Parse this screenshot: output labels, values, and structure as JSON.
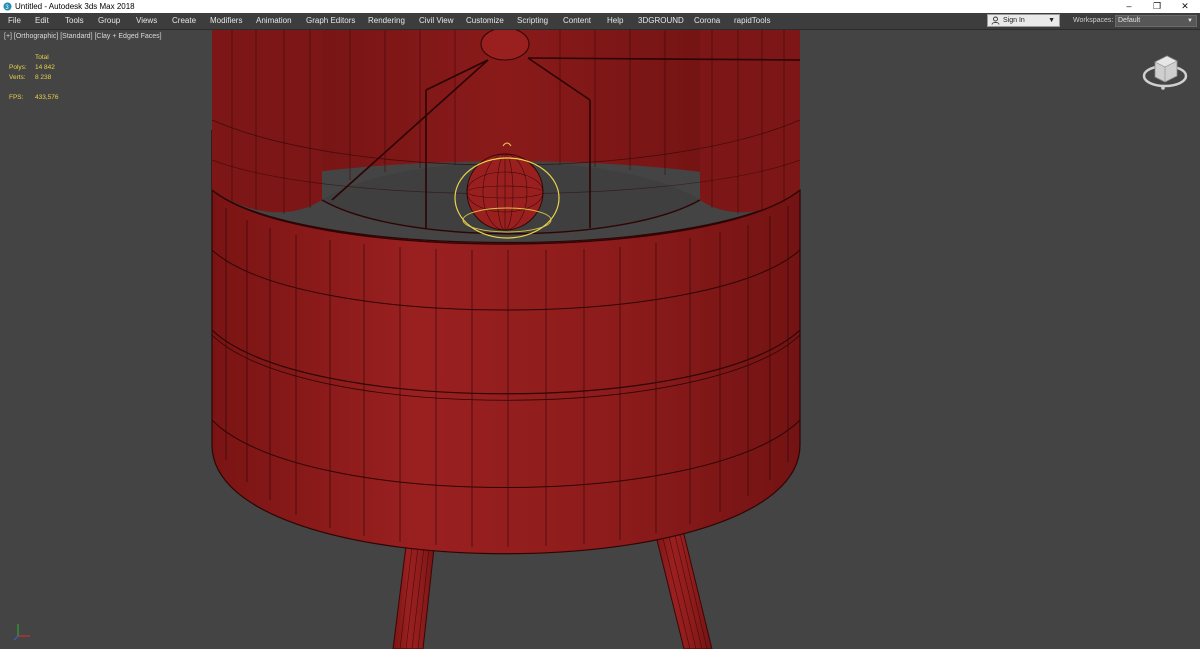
{
  "window": {
    "title": "Untitled - Autodesk 3ds Max 2018",
    "controls": {
      "minimize": "–",
      "restore": "❐",
      "close": "✕"
    }
  },
  "menu": {
    "items": [
      "File",
      "Edit",
      "Tools",
      "Group",
      "Views",
      "Create",
      "Modifiers",
      "Animation",
      "Graph Editors",
      "Rendering",
      "Civil View",
      "Customize",
      "Scripting",
      "Content",
      "Help",
      "3DGROUND",
      "Corona",
      "rapidTools"
    ]
  },
  "account": {
    "sign_in": "Sign In",
    "caret": "▼"
  },
  "workspaces": {
    "label": "Workspaces:",
    "value": "Default",
    "caret": "▼"
  },
  "viewport": {
    "label": "[+] [Orthographic] [Standard] [Clay + Edged Faces]",
    "stats": {
      "header": "Total",
      "polys_label": "Polys:",
      "polys": "14 842",
      "verts_label": "Verts:",
      "verts": "8 238",
      "fps_label": "FPS:",
      "fps": "433,576"
    }
  },
  "colors": {
    "model": "#8b1a1a",
    "model_edges": "#3a0606",
    "selection": "#e8d24a",
    "viewport_bg": "#444444",
    "interior": "#3f3f3f"
  }
}
